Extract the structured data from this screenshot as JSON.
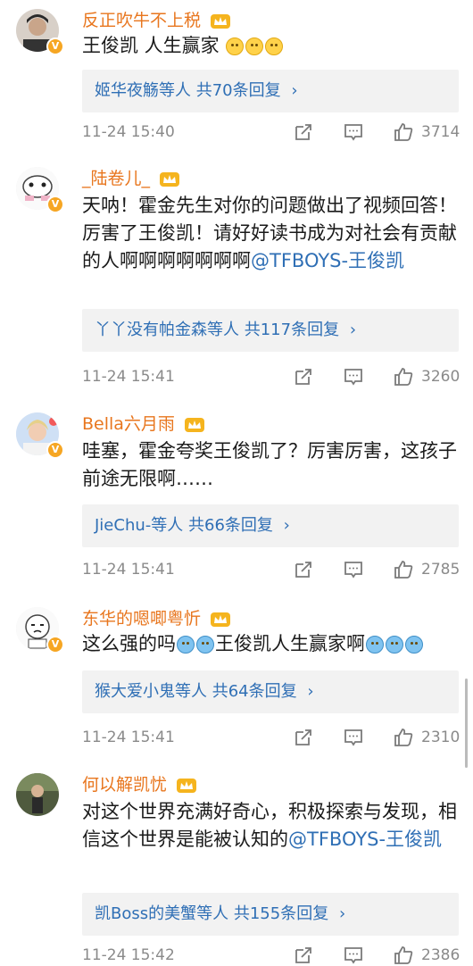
{
  "comments": [
    {
      "username": "反正吹牛不上税",
      "body": "王俊凯 人生赢家",
      "emojis": 3,
      "reply": {
        "names": "姬华夜觞等人",
        "count": "共70条回复"
      },
      "time": "11-24 15:40",
      "likes": "3714"
    },
    {
      "username": "_陆卷儿_",
      "body": "天呐！霍金先生对你的问题做出了视频回答！厉害了王俊凯！请好好读书成为对社会有贡献的人啊啊啊啊啊啊啊",
      "mention": "@TFBOYS-王俊凯",
      "reply": {
        "names": "丫丫没有帕金森等人",
        "count": "共117条回复"
      },
      "time": "11-24 15:41",
      "likes": "3260"
    },
    {
      "username": "Bella六月雨",
      "body": "哇塞，霍金夸奖王俊凯了？厉害厉害，这孩子前途无限啊……",
      "reply": {
        "names": "JieChu-等人",
        "count": "共66条回复"
      },
      "time": "11-24 15:41",
      "likes": "2785"
    },
    {
      "username": "东华的嗯唧粤忻",
      "body_a": "这么强的吗",
      "body_b": "王俊凯人生赢家啊",
      "reply": {
        "names": "猴大爱小鬼等人",
        "count": "共64条回复"
      },
      "time": "11-24 15:41",
      "likes": "2310"
    },
    {
      "username": "何以解凯忧",
      "body": "对这个世界充满好奇心，积极探索与发现，相信这个世界是能被认知的",
      "mention": "@TFBOYS-王俊凯",
      "reply": {
        "names": "凯Boss的美蟹等人",
        "count": "共155条回复"
      },
      "time": "11-24 15:42",
      "likes": "2386"
    }
  ],
  "icons": {
    "badge": "v-badge-icon",
    "crown": "crown-icon",
    "share": "share-icon",
    "comment": "comment-icon",
    "like": "thumb-up-icon",
    "chevron": "chevron-right-icon"
  },
  "colors": {
    "username": "#e8761e",
    "link": "#2f6fb5",
    "meta": "#8a8a8a",
    "reply_bg": "#f2f2f2"
  },
  "chevron_glyph": "›"
}
